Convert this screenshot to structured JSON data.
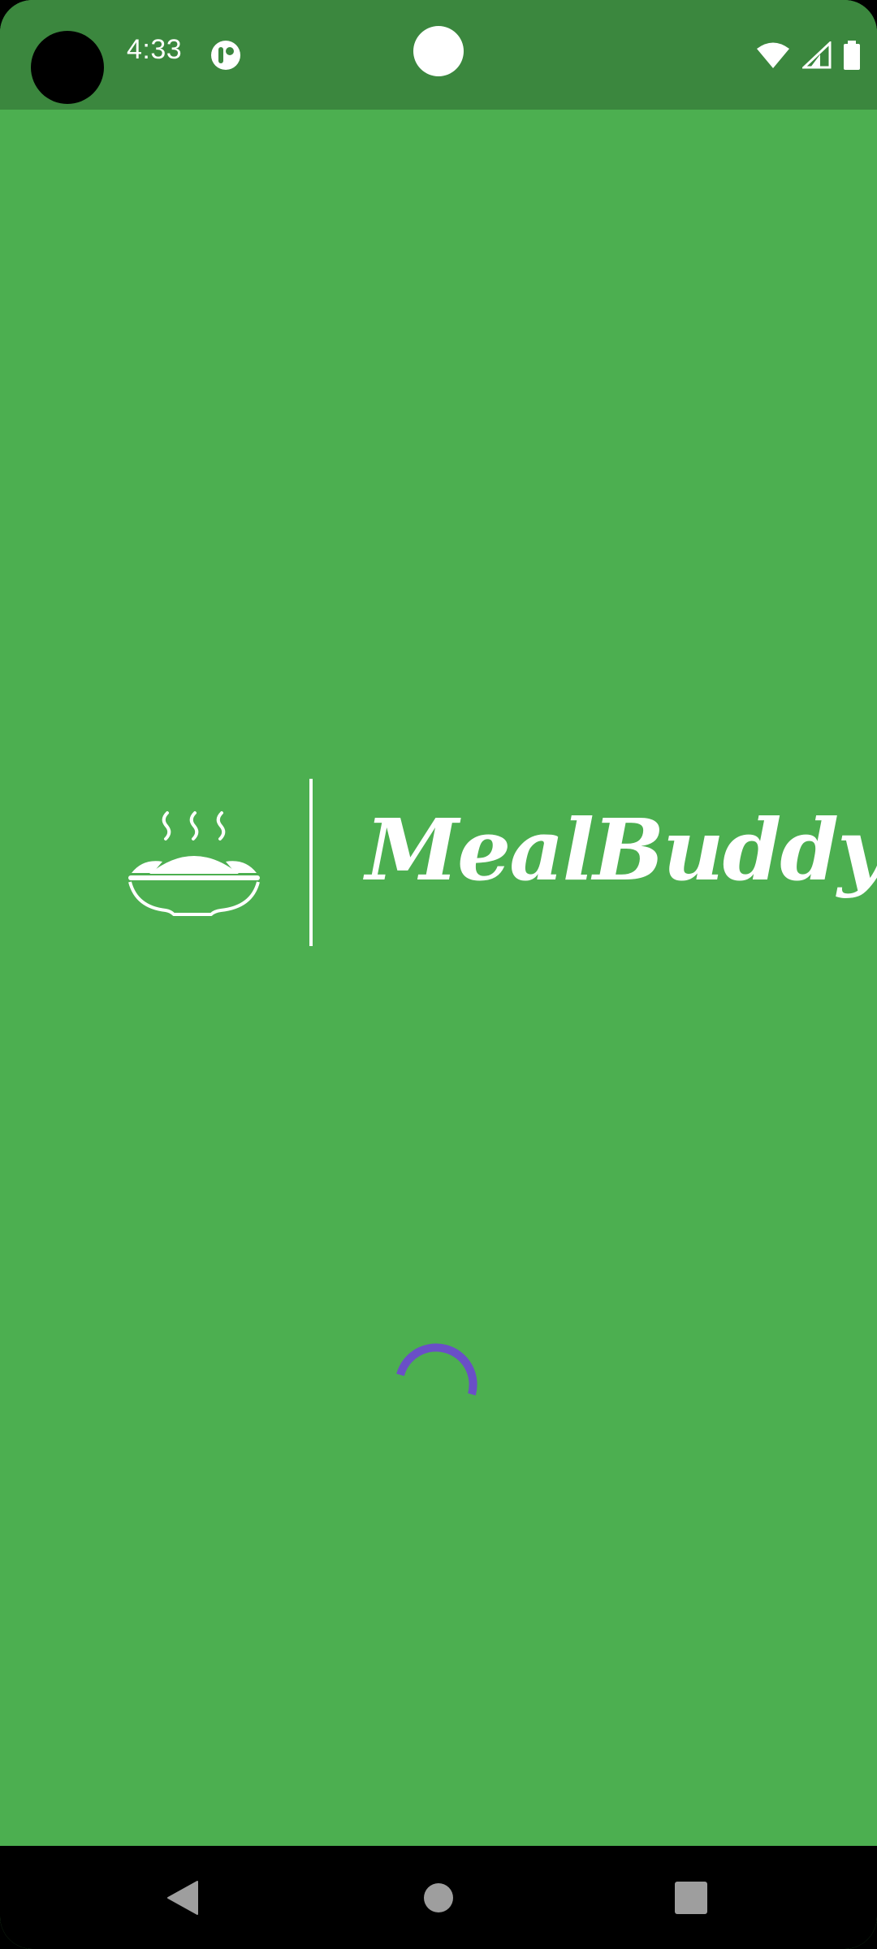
{
  "status_bar": {
    "time": "4:33",
    "icons": [
      "camera-cutout",
      "app-notification-icon",
      "wifi-icon",
      "signal-icon",
      "battery-icon"
    ]
  },
  "splash": {
    "app_name": "MealBuddy",
    "logo_icon": "steaming-bowl-icon",
    "background_color": "#4CAF50",
    "loading_indicator_color": "#6A4FC7"
  },
  "nav_bar": {
    "buttons": [
      "back-icon",
      "home-icon",
      "recents-icon"
    ]
  }
}
